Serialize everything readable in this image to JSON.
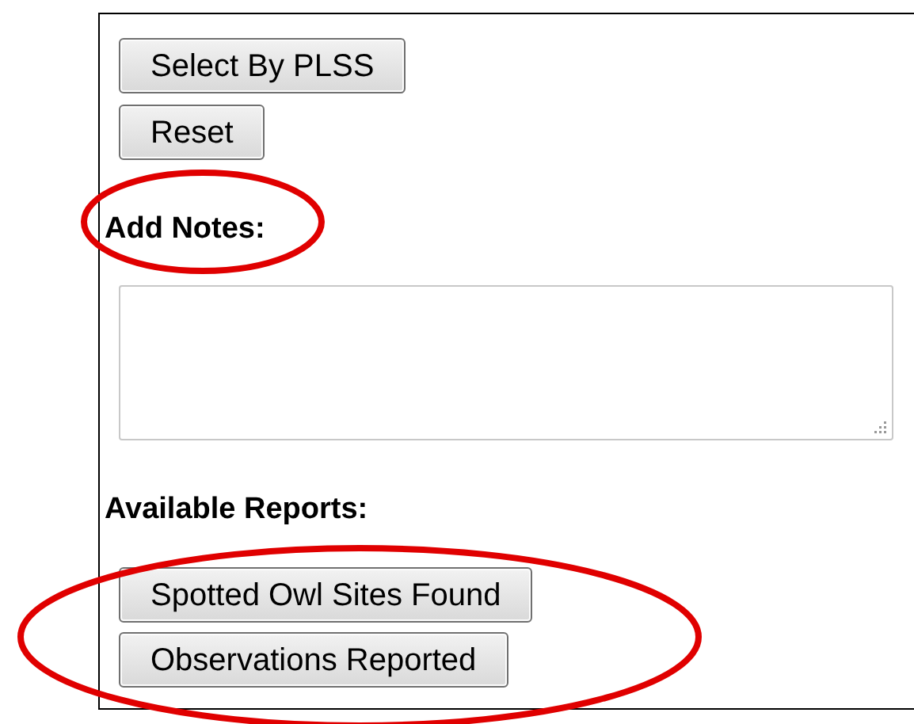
{
  "select_buttons": [
    "Select By PLSS",
    "Reset"
  ],
  "notes": {
    "label": "Add Notes:"
  },
  "reports": {
    "label": "Available Reports:",
    "buttons": [
      "Spotted Owl Sites Found",
      "Observations Reported"
    ]
  }
}
